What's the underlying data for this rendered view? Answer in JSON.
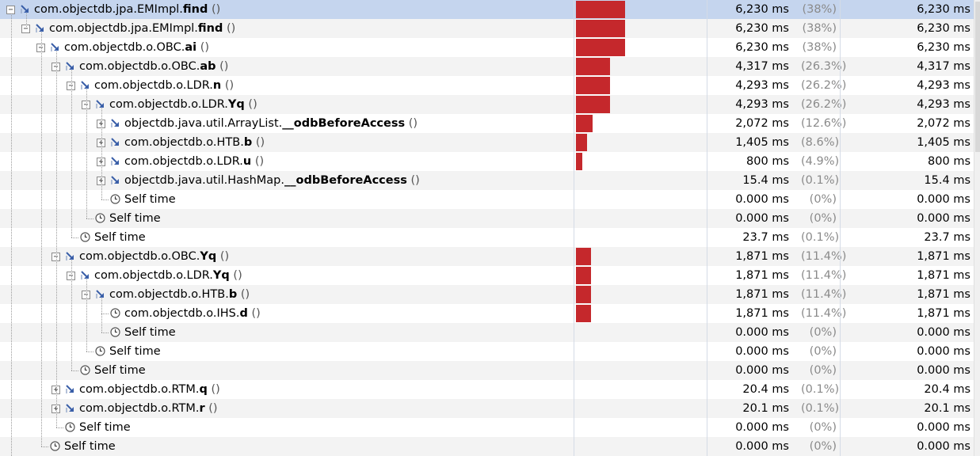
{
  "rows": [
    {
      "indent": 0,
      "icon": "method",
      "expander": "minus",
      "cls": "com.objectdb.jpa.EMImpl.",
      "method": "find",
      "args": " ()",
      "ms": "6,230 ms",
      "pct": "(38%)",
      "own": "6,230 ms",
      "bar_pct": 38.0
    },
    {
      "indent": 1,
      "icon": "method",
      "expander": "minus",
      "cls": "com.objectdb.jpa.EMImpl.",
      "method": "find",
      "args": " ()",
      "ms": "6,230 ms",
      "pct": "(38%)",
      "own": "6,230 ms",
      "bar_pct": 38.0
    },
    {
      "indent": 2,
      "icon": "method",
      "expander": "minus",
      "cls": "com.objectdb.o.OBC.",
      "method": "ai",
      "args": " ()",
      "ms": "6,230 ms",
      "pct": "(38%)",
      "own": "6,230 ms",
      "bar_pct": 38.0
    },
    {
      "indent": 3,
      "icon": "method",
      "expander": "minus",
      "cls": "com.objectdb.o.OBC.",
      "method": "ab",
      "args": " ()",
      "ms": "4,317 ms",
      "pct": "(26.3%)",
      "own": "4,317 ms",
      "bar_pct": 26.3
    },
    {
      "indent": 4,
      "icon": "method",
      "expander": "minus",
      "cls": "com.objectdb.o.LDR.",
      "method": "n",
      "args": " ()",
      "ms": "4,293 ms",
      "pct": "(26.2%)",
      "own": "4,293 ms",
      "bar_pct": 26.2
    },
    {
      "indent": 5,
      "icon": "method",
      "expander": "minus",
      "cls": "com.objectdb.o.LDR.",
      "method": "Yq",
      "args": " ()",
      "ms": "4,293 ms",
      "pct": "(26.2%)",
      "own": "4,293 ms",
      "bar_pct": 26.2
    },
    {
      "indent": 6,
      "icon": "method",
      "expander": "plus",
      "cls": "objectdb.java.util.ArrayList.",
      "method": "__odbBeforeAccess",
      "args": " ()",
      "ms": "2,072 ms",
      "pct": "(12.6%)",
      "own": "2,072 ms",
      "bar_pct": 12.6
    },
    {
      "indent": 6,
      "icon": "method",
      "expander": "plus",
      "cls": "com.objectdb.o.HTB.",
      "method": "b",
      "args": " ()",
      "ms": "1,405 ms",
      "pct": "(8.6%)",
      "own": "1,405 ms",
      "bar_pct": 8.6
    },
    {
      "indent": 6,
      "icon": "method",
      "expander": "plus",
      "cls": "com.objectdb.o.LDR.",
      "method": "u",
      "args": " ()",
      "ms": "800 ms",
      "pct": "(4.9%)",
      "own": "800 ms",
      "bar_pct": 4.9
    },
    {
      "indent": 6,
      "icon": "method",
      "expander": "plus",
      "cls": "objectdb.java.util.HashMap.",
      "method": "__odbBeforeAccess",
      "args": " ()",
      "ms": "15.4 ms",
      "pct": "(0.1%)",
      "own": "15.4 ms",
      "bar_pct": 0.1
    },
    {
      "indent": 6,
      "icon": "clock",
      "expander": "none",
      "cls": "Self time",
      "method": "",
      "args": "",
      "ms": "0.000 ms",
      "pct": "(0%)",
      "own": "0.000 ms",
      "bar_pct": 0
    },
    {
      "indent": 5,
      "icon": "clock",
      "expander": "none",
      "cls": "Self time",
      "method": "",
      "args": "",
      "ms": "0.000 ms",
      "pct": "(0%)",
      "own": "0.000 ms",
      "bar_pct": 0
    },
    {
      "indent": 4,
      "icon": "clock",
      "expander": "none",
      "cls": "Self time",
      "method": "",
      "args": "",
      "ms": "23.7 ms",
      "pct": "(0.1%)",
      "own": "23.7 ms",
      "bar_pct": 0.1
    },
    {
      "indent": 3,
      "icon": "method",
      "expander": "minus",
      "cls": "com.objectdb.o.OBC.",
      "method": "Yq",
      "args": " ()",
      "ms": "1,871 ms",
      "pct": "(11.4%)",
      "own": "1,871 ms",
      "bar_pct": 11.4
    },
    {
      "indent": 4,
      "icon": "method",
      "expander": "minus",
      "cls": "com.objectdb.o.LDR.",
      "method": "Yq",
      "args": " ()",
      "ms": "1,871 ms",
      "pct": "(11.4%)",
      "own": "1,871 ms",
      "bar_pct": 11.4
    },
    {
      "indent": 5,
      "icon": "method",
      "expander": "minus",
      "cls": "com.objectdb.o.HTB.",
      "method": "b",
      "args": " ()",
      "ms": "1,871 ms",
      "pct": "(11.4%)",
      "own": "1,871 ms",
      "bar_pct": 11.4
    },
    {
      "indent": 6,
      "icon": "clock",
      "expander": "none",
      "cls": "com.objectdb.o.IHS.",
      "method": "d",
      "args": " ()",
      "ms": "1,871 ms",
      "pct": "(11.4%)",
      "own": "1,871 ms",
      "bar_pct": 11.4
    },
    {
      "indent": 6,
      "icon": "clock",
      "expander": "none",
      "cls": "Self time",
      "method": "",
      "args": "",
      "ms": "0.000 ms",
      "pct": "(0%)",
      "own": "0.000 ms",
      "bar_pct": 0
    },
    {
      "indent": 5,
      "icon": "clock",
      "expander": "none",
      "cls": "Self time",
      "method": "",
      "args": "",
      "ms": "0.000 ms",
      "pct": "(0%)",
      "own": "0.000 ms",
      "bar_pct": 0
    },
    {
      "indent": 4,
      "icon": "clock",
      "expander": "none",
      "cls": "Self time",
      "method": "",
      "args": "",
      "ms": "0.000 ms",
      "pct": "(0%)",
      "own": "0.000 ms",
      "bar_pct": 0
    },
    {
      "indent": 3,
      "icon": "method",
      "expander": "plus",
      "cls": "com.objectdb.o.RTM.",
      "method": "q",
      "args": " ()",
      "ms": "20.4 ms",
      "pct": "(0.1%)",
      "own": "20.4 ms",
      "bar_pct": 0.1
    },
    {
      "indent": 3,
      "icon": "method",
      "expander": "plus",
      "cls": "com.objectdb.o.RTM.",
      "method": "r",
      "args": " ()",
      "ms": "20.1 ms",
      "pct": "(0.1%)",
      "own": "20.1 ms",
      "bar_pct": 0.1
    },
    {
      "indent": 3,
      "icon": "clock",
      "expander": "none",
      "cls": "Self time",
      "method": "",
      "args": "",
      "ms": "0.000 ms",
      "pct": "(0%)",
      "own": "0.000 ms",
      "bar_pct": 0
    },
    {
      "indent": 2,
      "icon": "clock",
      "expander": "none",
      "cls": "Self time",
      "method": "",
      "args": "",
      "ms": "0.000 ms",
      "pct": "(0%)",
      "own": "0.000 ms",
      "bar_pct": 0
    }
  ],
  "colors": {
    "bar": "#c5282c",
    "selected_row": "#c5d5ee",
    "alt_row": "#f3f3f3",
    "method_icon": "#3a5fa8"
  }
}
